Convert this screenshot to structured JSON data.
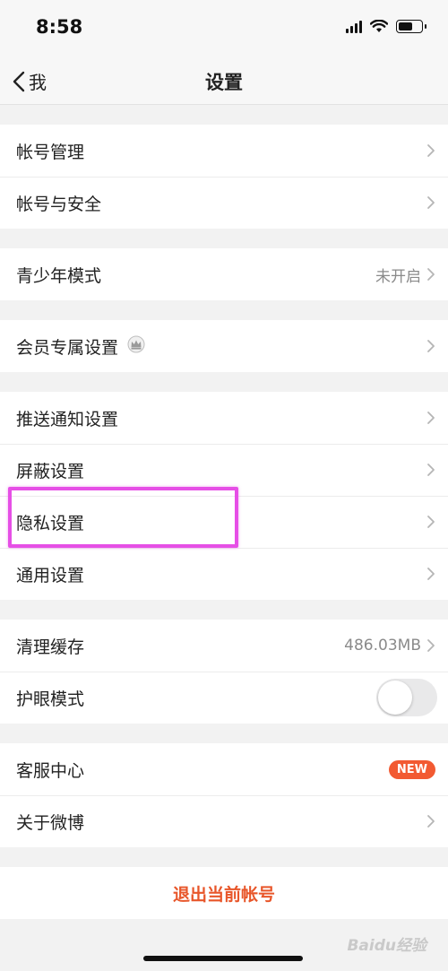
{
  "status_bar": {
    "time": "8:58"
  },
  "nav": {
    "back_label": "我",
    "title": "设置"
  },
  "groups": [
    [
      {
        "id": "account-manage",
        "label": "帐号管理",
        "accessory": "chevron"
      },
      {
        "id": "account-security",
        "label": "帐号与安全",
        "accessory": "chevron"
      }
    ],
    [
      {
        "id": "teen-mode",
        "label": "青少年模式",
        "value": "未开启",
        "accessory": "chevron"
      }
    ],
    [
      {
        "id": "vip-settings",
        "label": "会员专属设置",
        "icon": "crown-icon",
        "accessory": "chevron"
      }
    ],
    [
      {
        "id": "push-settings",
        "label": "推送通知设置",
        "accessory": "chevron"
      },
      {
        "id": "block-settings",
        "label": "屏蔽设置",
        "accessory": "chevron"
      },
      {
        "id": "privacy-settings",
        "label": "隐私设置",
        "accessory": "chevron",
        "highlighted": true
      },
      {
        "id": "general-settings",
        "label": "通用设置",
        "accessory": "chevron"
      }
    ],
    [
      {
        "id": "clear-cache",
        "label": "清理缓存",
        "value": "486.03MB",
        "accessory": "chevron"
      },
      {
        "id": "eye-care-mode",
        "label": "护眼模式",
        "accessory": "toggle",
        "toggle_on": false
      }
    ],
    [
      {
        "id": "customer-service",
        "label": "客服中心",
        "accessory": "badge",
        "badge": "NEW"
      },
      {
        "id": "about-weibo",
        "label": "关于微博",
        "accessory": "chevron"
      }
    ]
  ],
  "logout": {
    "label": "退出当前帐号"
  },
  "watermark": "Baidu经验",
  "colors": {
    "accent": "#e8562a",
    "badge": "#f25a32",
    "highlight": "#e64fe6",
    "background": "#f2f2f2"
  }
}
